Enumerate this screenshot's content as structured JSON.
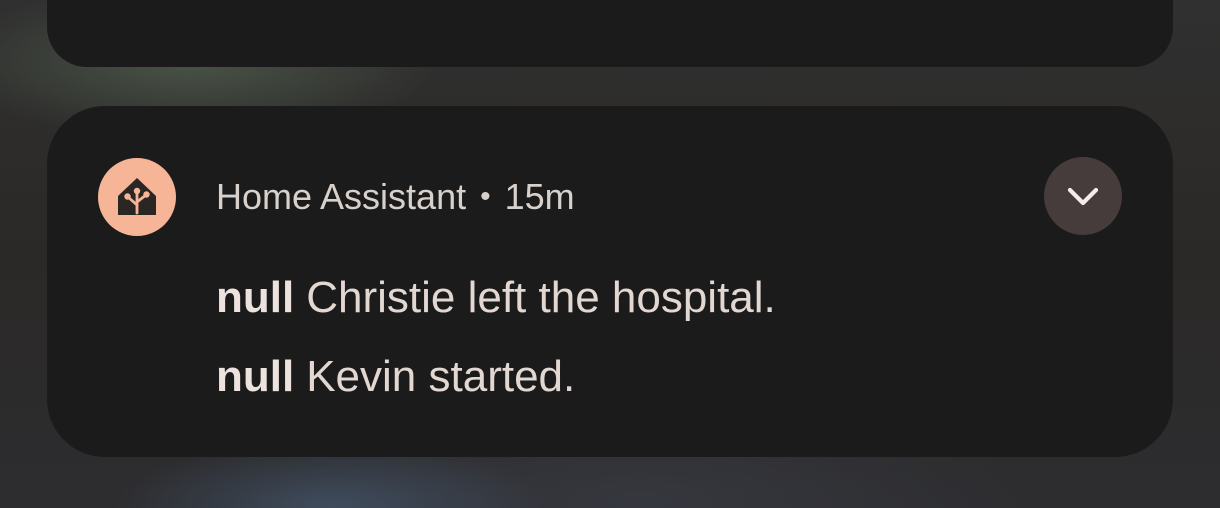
{
  "notification": {
    "app_name": "Home Assistant",
    "separator": "•",
    "time": "15m",
    "icon": "home-assistant-icon",
    "expand_icon": "chevron-down-icon",
    "messages": [
      {
        "sender": "null",
        "text": "Christie left the hospital."
      },
      {
        "sender": "null",
        "text": "Kevin started."
      }
    ]
  },
  "colors": {
    "icon_background": "#f7b598",
    "card_background": "#1b1b1b",
    "expand_button_background": "#453c3b"
  }
}
